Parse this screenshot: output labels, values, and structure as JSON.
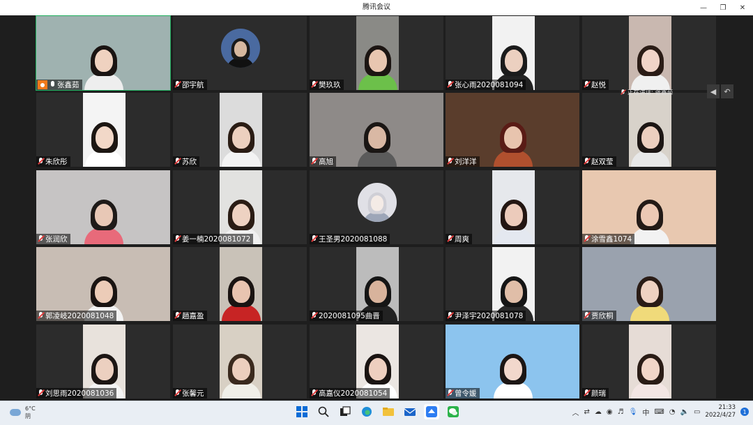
{
  "window": {
    "title": "腾讯会议",
    "controls": [
      "minimize",
      "restore",
      "close"
    ]
  },
  "speaking_indicator": "正在讲话: 张鑫茹",
  "participants": [
    {
      "name": "张鑫茹",
      "row": 0,
      "col": 0,
      "host": true,
      "mic": "on",
      "active": true,
      "view": "wide",
      "bg": "#9fb2b0",
      "hair": "#1a1412",
      "face": "#efd2c0",
      "shirt": "#eeeeee"
    },
    {
      "name": "邵宇航",
      "row": 0,
      "col": 1,
      "mic": "off",
      "view": "avatar",
      "bg": "#4a6aa0",
      "hair": "#1a1a1a",
      "face": "#d6b8a0",
      "shirt": "#111111"
    },
    {
      "name": "樊玖玖",
      "row": 0,
      "col": 2,
      "mic": "off",
      "view": "portrait",
      "bg": "#8a8a86",
      "hair": "#1c1512",
      "face": "#e8c6b0",
      "shirt": "#6cc04a"
    },
    {
      "name": "张心雨2020081094",
      "row": 0,
      "col": 3,
      "mic": "off",
      "view": "portrait",
      "bg": "#f2f2f2",
      "hair": "#1b1b1b",
      "face": "#ecd0c0",
      "shirt": "#222222"
    },
    {
      "name": "赵悦",
      "row": 0,
      "col": 4,
      "mic": "off",
      "view": "portrait",
      "bg": "#c9b8b0",
      "hair": "#2a1c16",
      "face": "#f0d4c8",
      "shirt": "#f0f0f0"
    },
    {
      "name": "朱欣彤",
      "row": 1,
      "col": 0,
      "mic": "off",
      "view": "portrait",
      "bg": "#f4f4f4",
      "hair": "#1c1612",
      "face": "#f2d8c8",
      "shirt": "#ffffff"
    },
    {
      "name": "苏欣",
      "row": 1,
      "col": 1,
      "mic": "off",
      "view": "portrait",
      "bg": "#dcdcdc",
      "hair": "#2a1c14",
      "face": "#ecd0bf",
      "shirt": "#f3f3f3"
    },
    {
      "name": "高旭",
      "row": 1,
      "col": 2,
      "mic": "off",
      "view": "wide",
      "bg": "#8e8a88",
      "hair": "#1a1614",
      "face": "#d9b8a4",
      "shirt": "#5b5b5b"
    },
    {
      "name": "刘洋洋",
      "row": 1,
      "col": 3,
      "mic": "off",
      "view": "wide",
      "bg": "#5a3d2c",
      "hair": "#5a1c16",
      "face": "#e8c4ae",
      "shirt": "#b0502e"
    },
    {
      "name": "赵双莹",
      "row": 1,
      "col": 4,
      "mic": "off",
      "view": "portrait",
      "bg": "#d8d2ca",
      "hair": "#1c1614",
      "face": "#eccfbf",
      "shirt": "#e8e8e8"
    },
    {
      "name": "张润欣",
      "row": 2,
      "col": 0,
      "mic": "off",
      "view": "wide",
      "bg": "#c6c4c4",
      "hair": "#1e1a18",
      "face": "#e8c8b6",
      "shirt": "#e86a7a"
    },
    {
      "name": "姜一楠2020081072",
      "row": 2,
      "col": 1,
      "mic": "off",
      "view": "portrait",
      "bg": "#e2e2e0",
      "hair": "#2a1c14",
      "face": "#eed2c2",
      "shirt": "#f0f0f0"
    },
    {
      "name": "王圣男2020081088",
      "row": 2,
      "col": 2,
      "mic": "off",
      "view": "avatar",
      "bg": "#e0e0e6",
      "hair": "#cfcfd6",
      "face": "#f4ebe6",
      "shirt": "#9da6b8"
    },
    {
      "name": "周爽",
      "row": 2,
      "col": 3,
      "mic": "off",
      "view": "portrait",
      "bg": "#e6e8ec",
      "hair": "#231612",
      "face": "#eccbbb",
      "shirt": "#e4e8f0"
    },
    {
      "name": "涂雪鑫1074",
      "row": 2,
      "col": 4,
      "mic": "off",
      "view": "wide",
      "bg": "#e8c8b0",
      "hair": "#231a16",
      "face": "#ecc8b4",
      "shirt": "#f2f2f2"
    },
    {
      "name": "郭凌岐2020081048",
      "row": 3,
      "col": 0,
      "mic": "off",
      "view": "wide",
      "bg": "#c8bdb4",
      "hair": "#1a1412",
      "face": "#ecccb8",
      "shirt": "#f3f3f3"
    },
    {
      "name": "趙嘉盈",
      "row": 3,
      "col": 1,
      "mic": "off",
      "view": "portrait",
      "bg": "#c9c2b8",
      "hair": "#1a1412",
      "face": "#e8c4b0",
      "shirt": "#c72424"
    },
    {
      "name": "2020081095曲晋",
      "row": 3,
      "col": 2,
      "mic": "off",
      "view": "portrait",
      "bg": "#bcbcbc",
      "hair": "#151515",
      "face": "#d8b39c",
      "shirt": "#222222"
    },
    {
      "name": "尹泽宇2020081078",
      "row": 3,
      "col": 3,
      "mic": "off",
      "view": "portrait",
      "bg": "#f2f2f2",
      "hair": "#151515",
      "face": "#e0bea8",
      "shirt": "#2a2a2a"
    },
    {
      "name": "贾欣桐",
      "row": 3,
      "col": 4,
      "mic": "off",
      "view": "wide",
      "bg": "#9aa2ae",
      "hair": "#2a1c16",
      "face": "#efd2c2",
      "shirt": "#f0da7a"
    },
    {
      "name": "刘思雨2020081036",
      "row": 4,
      "col": 0,
      "mic": "off",
      "view": "portrait",
      "bg": "#e8e2dc",
      "hair": "#1c1614",
      "face": "#ecd0c0",
      "shirt": "#f4f4f4"
    },
    {
      "name": "张馨元",
      "row": 4,
      "col": 1,
      "mic": "off",
      "view": "portrait",
      "bg": "#d8d0c4",
      "hair": "#3a2a1e",
      "face": "#eccfbe",
      "shirt": "#f0efe8"
    },
    {
      "name": "高嘉仪2020081054",
      "row": 4,
      "col": 2,
      "mic": "off",
      "view": "portrait",
      "bg": "#ebe6e2",
      "hair": "#1a1412",
      "face": "#eecfbf",
      "shirt": "#ffffff"
    },
    {
      "name": "曾令媛",
      "row": 4,
      "col": 3,
      "mic": "off",
      "view": "wide",
      "bg": "#8cc4ee",
      "hair": "#1c1614",
      "face": "#f2d8cc",
      "shirt": "#ffffff"
    },
    {
      "name": "颜瑞",
      "row": 4,
      "col": 4,
      "mic": "off",
      "view": "portrait",
      "bg": "#e6dcd6",
      "hair": "#2a1c16",
      "face": "#f2d6c8",
      "shirt": "#f3e6e4"
    }
  ],
  "taskbar": {
    "weather": {
      "temp": "6°C",
      "condition": "阴"
    },
    "apps": [
      "windows-start-icon",
      "search-icon",
      "task-view-icon",
      "edge-icon",
      "file-explorer-icon",
      "mail-icon",
      "tencent-meeting-icon",
      "wechat-icon"
    ],
    "ime": "中",
    "time": "21:33",
    "date": "2022/4/27",
    "notifications": "1"
  }
}
